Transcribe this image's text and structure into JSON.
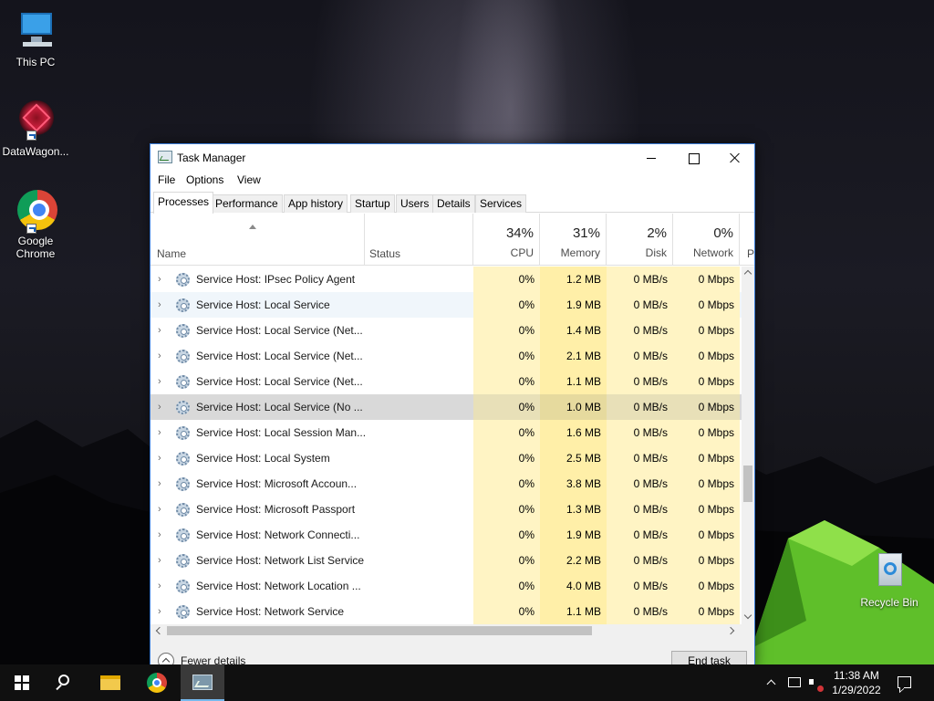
{
  "desktop": {
    "icons": [
      {
        "label": "This PC"
      },
      {
        "label": "DataWagon..."
      },
      {
        "label": "Google Chrome"
      },
      {
        "label": "Recycle Bin"
      }
    ]
  },
  "window": {
    "title": "Task Manager",
    "menu": [
      "File",
      "Options",
      "View"
    ],
    "tabs": [
      "Processes",
      "Performance",
      "App history",
      "Startup",
      "Users",
      "Details",
      "Services"
    ],
    "active_tab": "Processes",
    "columns": {
      "name": "Name",
      "status": "Status",
      "cpu": {
        "pct": "34%",
        "label": "CPU"
      },
      "memory": {
        "pct": "31%",
        "label": "Memory"
      },
      "disk": {
        "pct": "2%",
        "label": "Disk"
      },
      "network": {
        "pct": "0%",
        "label": "Network"
      },
      "next_col_initial": "P"
    },
    "rows": [
      {
        "name": "Service Host: IPsec Policy Agent",
        "cpu": "0%",
        "memory": "1.2 MB",
        "disk": "0 MB/s",
        "network": "0 Mbps"
      },
      {
        "name": "Service Host: Local Service",
        "cpu": "0%",
        "memory": "1.9 MB",
        "disk": "0 MB/s",
        "network": "0 Mbps"
      },
      {
        "name": "Service Host: Local Service (Net...",
        "cpu": "0%",
        "memory": "1.4 MB",
        "disk": "0 MB/s",
        "network": "0 Mbps"
      },
      {
        "name": "Service Host: Local Service (Net...",
        "cpu": "0%",
        "memory": "2.1 MB",
        "disk": "0 MB/s",
        "network": "0 Mbps"
      },
      {
        "name": "Service Host: Local Service (Net...",
        "cpu": "0%",
        "memory": "1.1 MB",
        "disk": "0 MB/s",
        "network": "0 Mbps"
      },
      {
        "name": "Service Host: Local Service (No ...",
        "cpu": "0%",
        "memory": "1.0 MB",
        "disk": "0 MB/s",
        "network": "0 Mbps"
      },
      {
        "name": "Service Host: Local Session Man...",
        "cpu": "0%",
        "memory": "1.6 MB",
        "disk": "0 MB/s",
        "network": "0 Mbps"
      },
      {
        "name": "Service Host: Local System",
        "cpu": "0%",
        "memory": "2.5 MB",
        "disk": "0 MB/s",
        "network": "0 Mbps"
      },
      {
        "name": "Service Host: Microsoft Accoun...",
        "cpu": "0%",
        "memory": "3.8 MB",
        "disk": "0 MB/s",
        "network": "0 Mbps"
      },
      {
        "name": "Service Host: Microsoft Passport",
        "cpu": "0%",
        "memory": "1.3 MB",
        "disk": "0 MB/s",
        "network": "0 Mbps"
      },
      {
        "name": "Service Host: Network Connecti...",
        "cpu": "0%",
        "memory": "1.9 MB",
        "disk": "0 MB/s",
        "network": "0 Mbps"
      },
      {
        "name": "Service Host: Network List Service",
        "cpu": "0%",
        "memory": "2.2 MB",
        "disk": "0 MB/s",
        "network": "0 Mbps"
      },
      {
        "name": "Service Host: Network Location ...",
        "cpu": "0%",
        "memory": "4.0 MB",
        "disk": "0 MB/s",
        "network": "0 Mbps"
      },
      {
        "name": "Service Host: Network Service",
        "cpu": "0%",
        "memory": "1.1 MB",
        "disk": "0 MB/s",
        "network": "0 Mbps"
      }
    ],
    "hover_row": 1,
    "selected_row": 5,
    "footer": {
      "fewer_details": "Fewer details",
      "end_task": "End task"
    }
  },
  "taskbar": {
    "items": [
      "start-icon",
      "search-icon",
      "file-explorer-icon",
      "chrome-icon",
      "task-manager-icon"
    ],
    "clock_time": "11:38 AM",
    "clock_date": "1/29/2022"
  },
  "colors": {
    "cpu_col": "#fff4c4",
    "memory_col": "#ffefa8",
    "window_border": "#3a7bd5",
    "taskbar": "#101010"
  }
}
